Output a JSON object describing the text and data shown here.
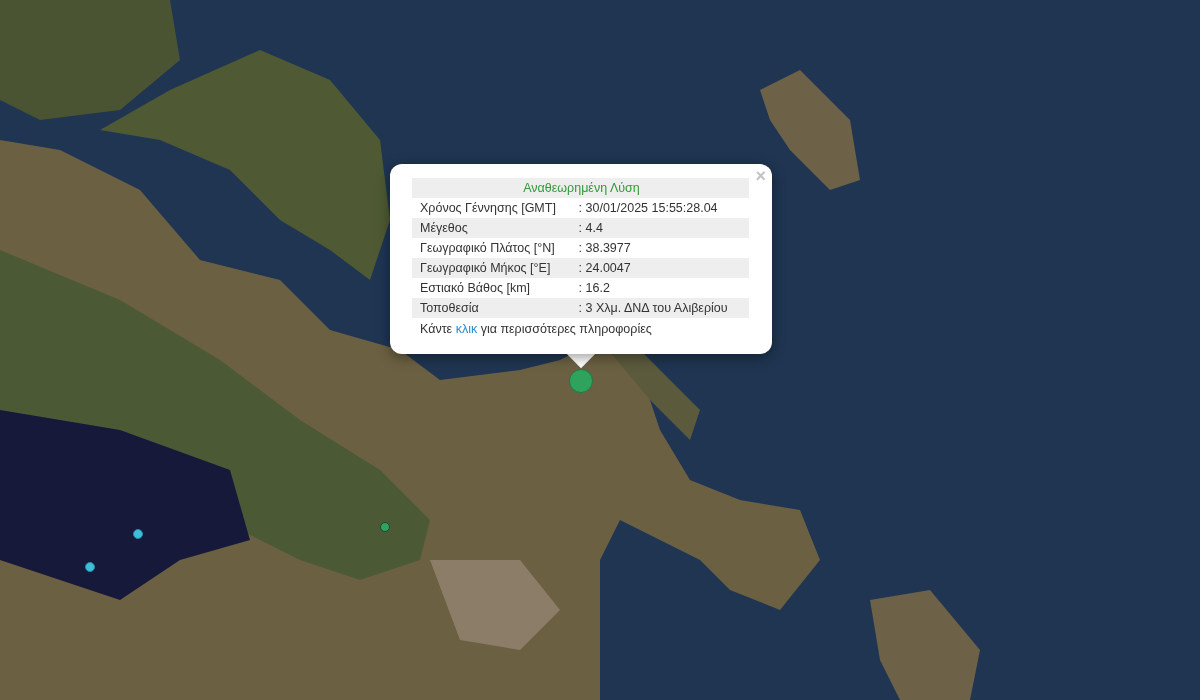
{
  "popup": {
    "title": "Αναθεωρημένη Λύση",
    "close": "×",
    "rows": [
      {
        "label": "Χρόνος Γέννησης [GMT]",
        "value": ": 30/01/2025 15:55:28.04"
      },
      {
        "label": "Μέγεθος",
        "value": ": 4.4"
      },
      {
        "label": "Γεωγραφικό Πλάτος [°N]",
        "value": ": 38.3977"
      },
      {
        "label": "Γεωγραφικό Μήκος [°E]",
        "value": ": 24.0047"
      },
      {
        "label": "Εστιακό Βάθος [km]",
        "value": ": 16.2"
      },
      {
        "label": "Τοποθεσία",
        "value": ": 3 Χλμ. ΔΝΔ του Αλιβερίου"
      }
    ],
    "footer": {
      "before": "Κάντε ",
      "link": "κλικ",
      "after": " για περισσότερες πληροφορίες"
    }
  },
  "markers": [
    {
      "kind": "large",
      "color": "#2fa35e"
    },
    {
      "kind": "small",
      "color": "#2fa35e"
    },
    {
      "kind": "small",
      "color": "#3cbfd8"
    },
    {
      "kind": "small",
      "color": "#3cbfd8"
    }
  ]
}
